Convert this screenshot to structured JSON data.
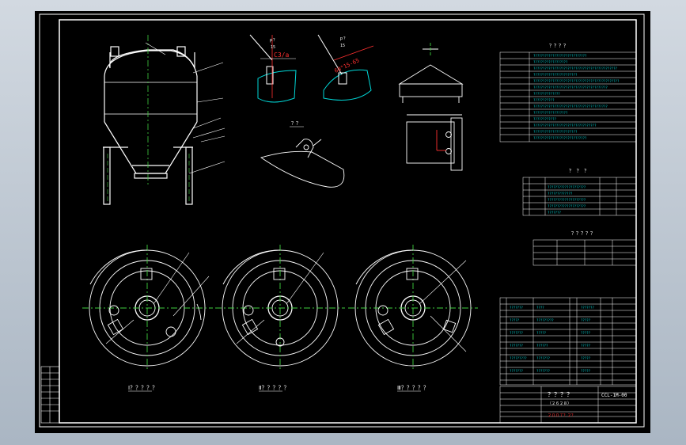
{
  "title_block": {
    "title": "？？？？",
    "drawing_no": "CCL-1M-00",
    "name": "（２６２８）",
    "company": "２００７？２？",
    "sheet": "？ ？ ？"
  },
  "views": {
    "a": "Ⅰ？？？？？",
    "b": "Ⅱ？？？？？",
    "c": "Ⅲ？？？？？"
  },
  "details": {
    "weld1": "C3/a",
    "weld2": "60°15-65"
  },
  "tables": {
    "tech_title": "？？？？",
    "nozzle_title": "？ ？ ？",
    "spec_title": "？？？？？"
  },
  "colors": {
    "outline": "#ffffff",
    "dim": "#00d8d8",
    "center": "#40d040",
    "text": "#ff3030",
    "accent": "#ff40ff"
  }
}
